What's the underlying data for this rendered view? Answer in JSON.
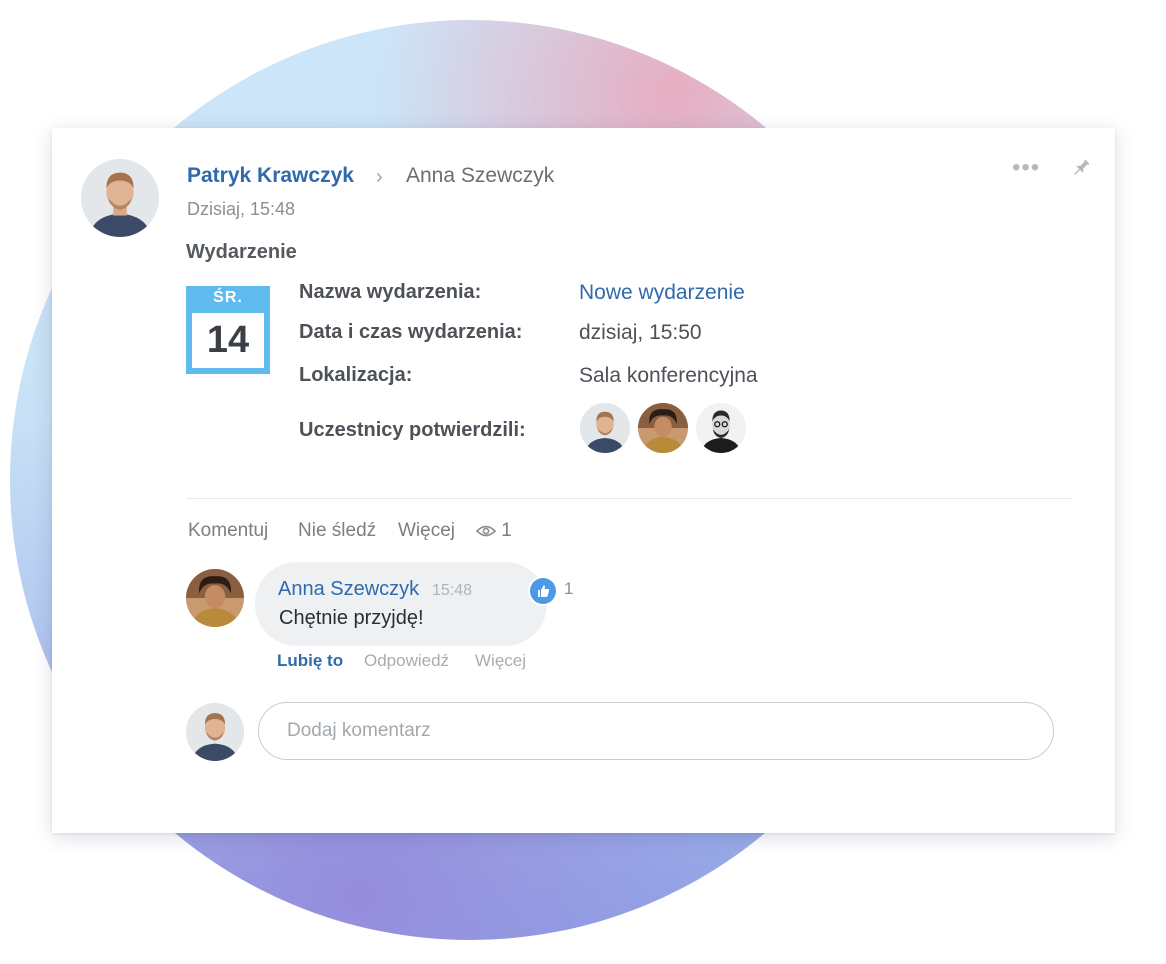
{
  "post": {
    "author": "Patryk Krawczyk",
    "recipient": "Anna Szewczyk",
    "timestamp": "Dzisiaj, 15:48",
    "type_label": "Wydarzenie",
    "menu_icon": "more-dots-icon",
    "pin_icon": "pin-icon"
  },
  "event": {
    "calendar_day": "ŚR.",
    "calendar_date": "14",
    "fields": [
      {
        "label": "Nazwa wydarzenia:",
        "value": "Nowe wydarzenie"
      },
      {
        "label": "Data i czas wydarzenia:",
        "value": "dzisiaj, 15:50"
      },
      {
        "label": "Lokalizacja:",
        "value": "Sala konferencyjna"
      },
      {
        "label": "Uczestnicy potwierdzili:",
        "value": ""
      }
    ]
  },
  "actions": {
    "comment": "Komentuj",
    "unfollow": "Nie śledź",
    "more": "Więcej",
    "views": "1"
  },
  "comment": {
    "author": "Anna Szewczyk",
    "time": "15:48",
    "text": "Chętnie przyjdę!",
    "like_count": "1",
    "like": "Lubię to",
    "reply": "Odpowiedź",
    "more": "Więcej"
  },
  "new_comment": {
    "placeholder": "Dodaj komentarz"
  },
  "colors": {
    "accent": "#2f6aad",
    "calendar": "#5ebaef",
    "like_badge": "#4a9ae8"
  }
}
